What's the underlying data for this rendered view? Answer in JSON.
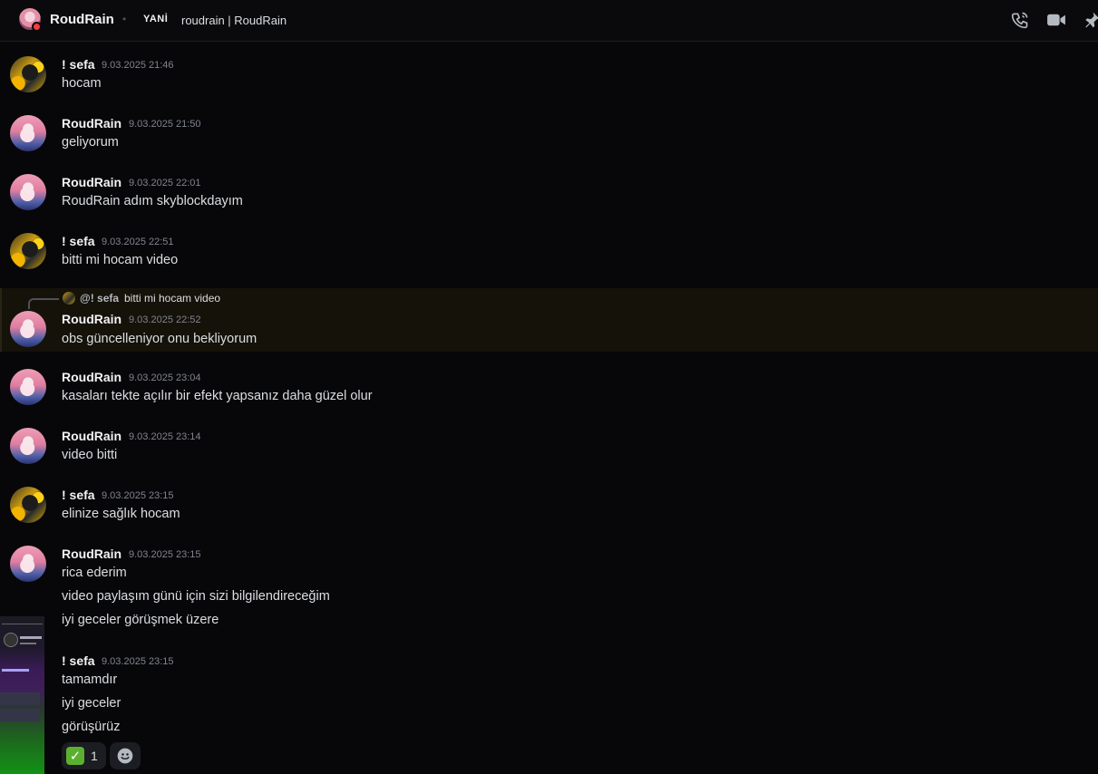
{
  "header": {
    "username": "RoudRain",
    "tag": "YANİ",
    "status": "roudrain | RoudRain",
    "icons": [
      "phone-call-icon",
      "video-call-icon",
      "pin-icon"
    ]
  },
  "reply": {
    "name": "@! sefa",
    "text": "bitti mi hocam video"
  },
  "messages": [
    {
      "author": "! sefa",
      "time": "9.03.2025 21:46",
      "lines": [
        "hocam"
      ]
    },
    {
      "author": "RoudRain",
      "time": "9.03.2025 21:50",
      "lines": [
        "geliyorum"
      ]
    },
    {
      "author": "RoudRain",
      "time": "9.03.2025 22:01",
      "lines": [
        "RoudRain adım skyblockdayım"
      ]
    },
    {
      "author": "! sefa",
      "time": "9.03.2025 22:51",
      "lines": [
        "bitti mi hocam video"
      ]
    },
    {
      "author": "RoudRain",
      "time": "9.03.2025 22:52",
      "lines": [
        "obs güncelleniyor onu bekliyorum"
      ]
    },
    {
      "author": "RoudRain",
      "time": "9.03.2025 23:04",
      "lines": [
        "kasaları tekte açılır bir efekt yapsanız daha güzel olur"
      ]
    },
    {
      "author": "RoudRain",
      "time": "9.03.2025 23:14",
      "lines": [
        "video bitti"
      ]
    },
    {
      "author": "! sefa",
      "time": "9.03.2025 23:15",
      "lines": [
        "elinize sağlık hocam"
      ]
    },
    {
      "author": "RoudRain",
      "time": "9.03.2025 23:15",
      "lines": [
        "rica ederim",
        "video paylaşım günü için sizi bilgilendireceğim",
        "iyi geceler görüşmek üzere"
      ]
    },
    {
      "author": "! sefa",
      "time": "9.03.2025 23:15",
      "lines": [
        "tamamdır",
        "iyi geceler",
        "görüşürüz"
      ]
    }
  ],
  "reaction": {
    "emoji": "✓",
    "count": "1"
  },
  "colors": {
    "background": "#070709",
    "highlight": "#15120a",
    "reaction_bg": "#1c1d22",
    "check_green": "#5bb12f",
    "dnd_red": "#f23f43"
  }
}
